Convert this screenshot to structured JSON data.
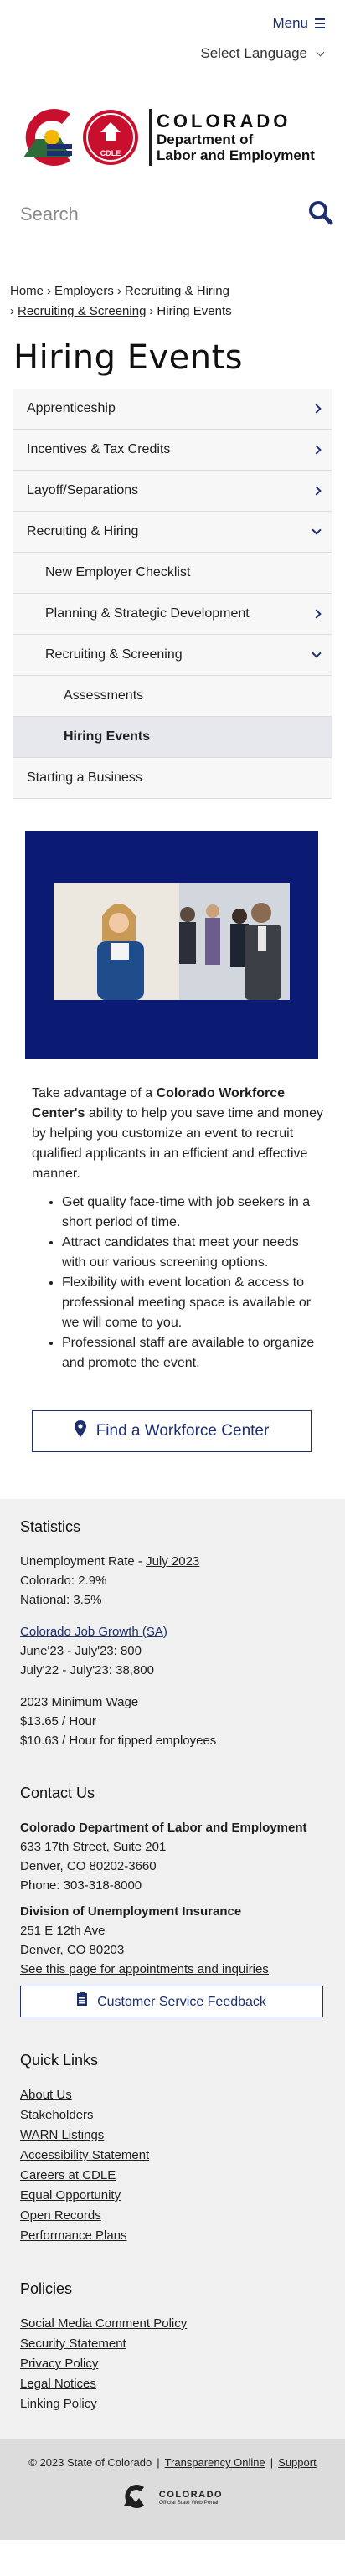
{
  "header": {
    "menu_label": "Menu",
    "language_label": "Select Language",
    "logo": {
      "state": "COLORADO",
      "dept_line1": "Department of",
      "dept_line2": "Labor and Employment",
      "badge": "CDLE"
    },
    "search_placeholder": "Search"
  },
  "breadcrumb": [
    "Home",
    "Employers",
    "Recruiting & Hiring",
    "Recruiting & Screening",
    "Hiring Events"
  ],
  "page_title": "Hiring Events",
  "sidenav": [
    {
      "label": "Apprenticeship"
    },
    {
      "label": "Incentives & Tax Credits"
    },
    {
      "label": "Layoff/Separations"
    },
    {
      "label": "Recruiting & Hiring"
    },
    {
      "label": "New Employer Checklist"
    },
    {
      "label": "Planning & Strategic Development"
    },
    {
      "label": "Recruiting & Screening"
    },
    {
      "label": "Assessments"
    },
    {
      "label": "Hiring Events"
    },
    {
      "label": "Starting a Business"
    }
  ],
  "content": {
    "intro_before": "Take advantage of a ",
    "intro_strong": "Colorado Workforce Center's",
    "intro_after": " ability to help you save time and money by helping you customize an event to recruit qualified applicants in an efficient and effective manner.",
    "bullets": [
      "Get quality face-time with job seekers in a short period of time.",
      "Attract candidates that meet your needs with our various screening options.",
      "Flexibility with event location & access to professional meeting space is available or we will come to you.",
      "Professional staff are available to organize and promote the event."
    ],
    "cta_label": "Find a Workforce Center"
  },
  "footer": {
    "statistics": {
      "heading": "Statistics",
      "unemp_label": "Unemployment Rate - ",
      "unemp_link": "July 2023",
      "colorado": "Colorado: 2.9%",
      "national": "National: 3.5%",
      "job_growth_link": "Colorado Job Growth (SA)",
      "growth_1": "June'23 - July'23: 800",
      "growth_2": "July'22 - July'23: 38,800",
      "wage_heading": "2023 Minimum Wage",
      "wage_1": "$13.65 / Hour",
      "wage_2": "$10.63 / Hour for tipped employees"
    },
    "contact": {
      "heading": "Contact Us",
      "org": "Colorado Department of Labor and Employment",
      "addr1": "633 17th Street, Suite 201",
      "addr2": "Denver, CO  80202-3660",
      "phone": "Phone: 303-318-8000",
      "ui_org": "Division of Unemployment Insurance",
      "ui_addr1": "251 E 12th Ave",
      "ui_addr2": "Denver, CO  80203",
      "appointments_link": "See this page for appointments and inquiries",
      "feedback_button": "Customer Service Feedback"
    },
    "quick_links": {
      "heading": "Quick Links",
      "items": [
        "About Us",
        "Stakeholders",
        "WARN Listings",
        "Accessibility Statement",
        "Careers at CDLE",
        "Equal Opportunity",
        "Open Records",
        "Performance Plans"
      ]
    },
    "policies": {
      "heading": "Policies",
      "items": [
        "Social Media Comment Policy",
        "Security Statement",
        "Privacy Policy",
        "Legal Notices",
        "Linking Policy"
      ]
    },
    "bottom": {
      "copyright": "© 2023 State of Colorado",
      "transparency": "Transparency Online",
      "support": "Support",
      "portal_name": "COLORADO",
      "portal_tag": "Official State Web Portal"
    }
  },
  "colors": {
    "brand_navy": "#1d2f6f",
    "hero_bg": "#0b1b73",
    "logo_red": "#c8102e",
    "logo_green": "#2e6b3a",
    "logo_gold": "#f2b705"
  }
}
